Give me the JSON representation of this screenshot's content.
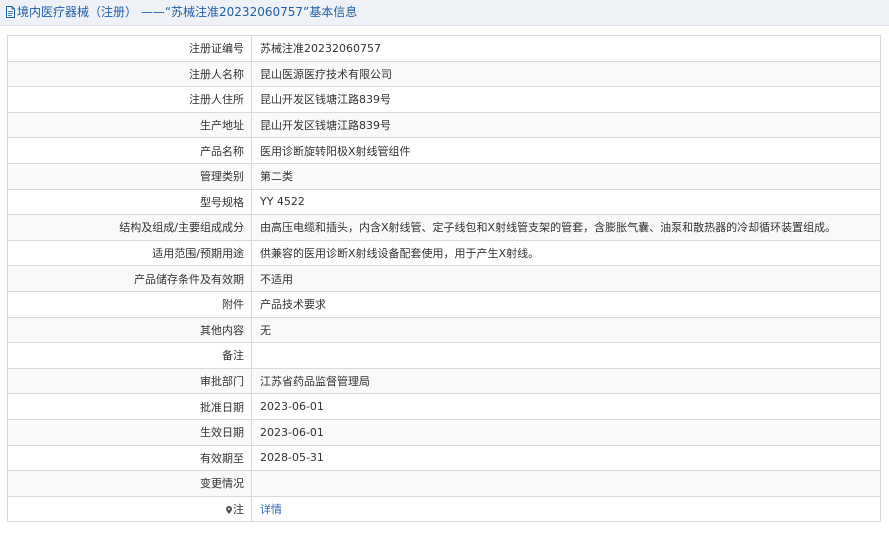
{
  "header": {
    "title": "境内医疗器械（注册） ——“苏械注准20232060757”基本信息",
    "icon": "document-icon",
    "title_color": "#1f5fa8"
  },
  "rows": [
    {
      "label": "注册证编号",
      "value": "苏械注准20232060757"
    },
    {
      "label": "注册人名称",
      "value": "昆山医源医疗技术有限公司"
    },
    {
      "label": "注册人住所",
      "value": "昆山开发区钱塘江路839号"
    },
    {
      "label": "生产地址",
      "value": "昆山开发区钱塘江路839号"
    },
    {
      "label": "产品名称",
      "value": "医用诊断旋转阳极X射线管组件"
    },
    {
      "label": "管理类别",
      "value": "第二类"
    },
    {
      "label": "型号规格",
      "value": "YY 4522"
    },
    {
      "label": "结构及组成/主要组成成分",
      "value": "由高压电缆和插头，内含X射线管、定子线包和X射线管支架的管套，含膨胀气囊、油泵和散热器的冷却循环装置组成。"
    },
    {
      "label": "适用范围/预期用途",
      "value": "供兼容的医用诊断X射线设备配套使用，用于产生X射线。"
    },
    {
      "label": "产品储存条件及有效期",
      "value": "不适用"
    },
    {
      "label": "附件",
      "value": "产品技术要求"
    },
    {
      "label": "其他内容",
      "value": "无"
    },
    {
      "label": "备注",
      "value": ""
    },
    {
      "label": "审批部门",
      "value": "江苏省药品监督管理局"
    },
    {
      "label": "批准日期",
      "value": "2023-06-01"
    },
    {
      "label": "生效日期",
      "value": "2023-06-01"
    },
    {
      "label": "有效期至",
      "value": "2028-05-31"
    },
    {
      "label": "变更情况",
      "value": ""
    }
  ],
  "note_row": {
    "label": "注",
    "icon": "pin-icon",
    "link_text": "详情",
    "link_color": "#2f6db5"
  }
}
